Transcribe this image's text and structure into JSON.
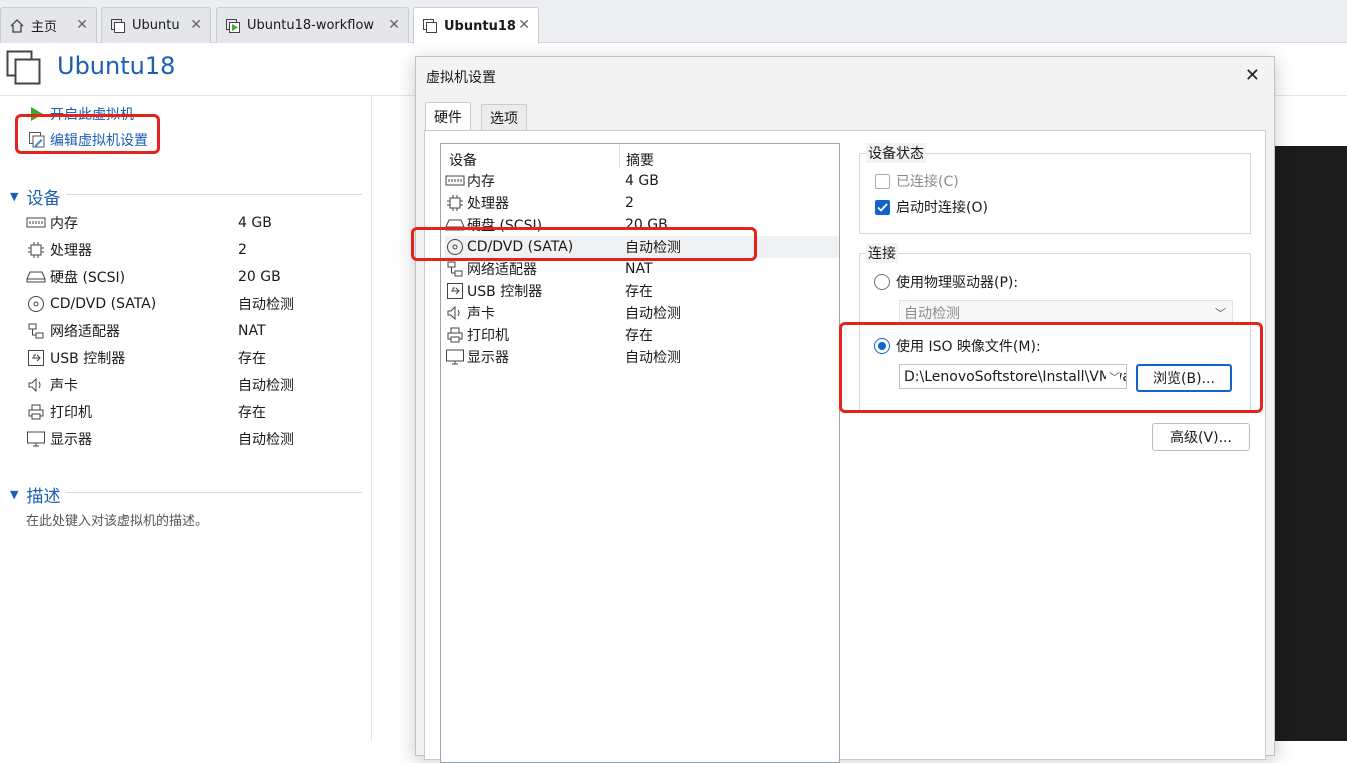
{
  "tabs": [
    {
      "label": "主页",
      "icon": "home-icon"
    },
    {
      "label": "Ubuntu",
      "icon": "vm-icon"
    },
    {
      "label": "Ubuntu18-workflow",
      "icon": "vm-running-icon"
    },
    {
      "label": "Ubuntu18",
      "icon": "vm-icon"
    }
  ],
  "vm": {
    "title": "Ubuntu18"
  },
  "actions": {
    "start": "开启此虚拟机",
    "edit": "编辑虚拟机设置"
  },
  "devices_section": {
    "title": "设备"
  },
  "devices": [
    {
      "name": "内存",
      "value": "4 GB"
    },
    {
      "name": "处理器",
      "value": "2"
    },
    {
      "name": "硬盘 (SCSI)",
      "value": "20 GB"
    },
    {
      "name": "CD/DVD (SATA)",
      "value": "自动检测"
    },
    {
      "name": "网络适配器",
      "value": "NAT"
    },
    {
      "name": "USB 控制器",
      "value": "存在"
    },
    {
      "name": "声卡",
      "value": "自动检测"
    },
    {
      "name": "打印机",
      "value": "存在"
    },
    {
      "name": "显示器",
      "value": "自动检测"
    }
  ],
  "description_section": {
    "title": "描述",
    "placeholder": "在此处键入对该虚拟机的描述。"
  },
  "dialog": {
    "title": "虚拟机设置",
    "close": "✕",
    "tabs": [
      "硬件",
      "选项"
    ],
    "list_headers": {
      "device": "设备",
      "summary": "摘要"
    },
    "hardware": [
      {
        "name": "内存",
        "value": "4 GB"
      },
      {
        "name": "处理器",
        "value": "2"
      },
      {
        "name": "硬盘 (SCSI)",
        "value": "20 GB"
      },
      {
        "name": "CD/DVD (SATA)",
        "value": "自动检测"
      },
      {
        "name": "网络适配器",
        "value": "NAT"
      },
      {
        "name": "USB 控制器",
        "value": "存在"
      },
      {
        "name": "声卡",
        "value": "自动检测"
      },
      {
        "name": "打印机",
        "value": "存在"
      },
      {
        "name": "显示器",
        "value": "自动检测"
      }
    ],
    "device_status": {
      "title": "设备状态",
      "connected": "已连接(C)",
      "connect_at_power_on": "启动时连接(O)"
    },
    "connection": {
      "title": "连接",
      "use_physical": "使用物理驱动器(P):",
      "physical_value": "自动检测",
      "use_iso": "使用 ISO 映像文件(M):",
      "iso_path": "D:\\LenovoSoftstore\\Install\\VMware",
      "browse": "浏览(B)...",
      "advanced": "高级(V)..."
    }
  },
  "colors": {
    "accent": "#1a5fb4",
    "highlight": "#e4231b",
    "checked": "#1463c9"
  }
}
